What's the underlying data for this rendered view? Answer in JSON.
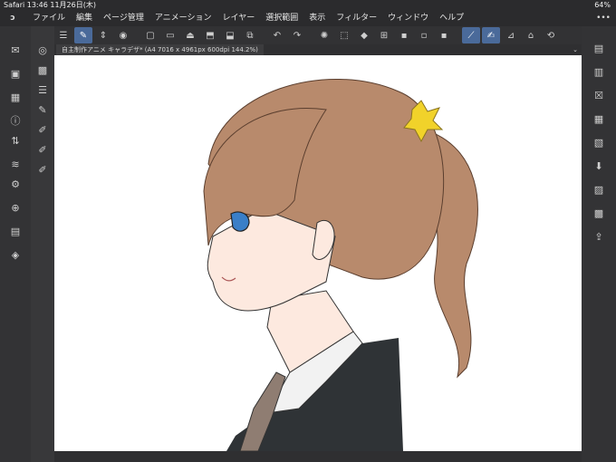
{
  "status": {
    "left": "Safari  13:46  11月26日(木)",
    "right": "64%"
  },
  "menu": {
    "items": [
      "ファイル",
      "編集",
      "ページ管理",
      "アニメーション",
      "レイヤー",
      "選択範囲",
      "表示",
      "フィルター",
      "ウィンドウ",
      "ヘルプ"
    ]
  },
  "tab": {
    "label": "自主制作アニメ キャラデザ* (A4 7016 x 4961px 600dpi 144.2%)"
  },
  "toolbar_icons": [
    "menu-icon",
    "pen-tool-icon",
    "updown-icon",
    "eye-icon",
    "new-file-icon",
    "open-folder-icon",
    "save-icon",
    "export-icon",
    "import-icon",
    "copy-icon",
    "undo-icon",
    "redo-icon",
    "spinner-icon",
    "transform-icon",
    "fill-icon",
    "crop-icon",
    "rect-icon",
    "rect2-icon",
    "rect3-icon",
    "pen-active-icon",
    "brush-icon",
    "ruler-icon",
    "layer-icon",
    "rotate-icon"
  ],
  "colors": {
    "hair": "#b88a6c",
    "hair_dark": "#8a5e45",
    "skin": "#fde9df",
    "jacket": "#2f3336",
    "shirt": "#f4f4f4",
    "eye": "#3a7fc8",
    "scrunchie": "#f1d22a"
  }
}
